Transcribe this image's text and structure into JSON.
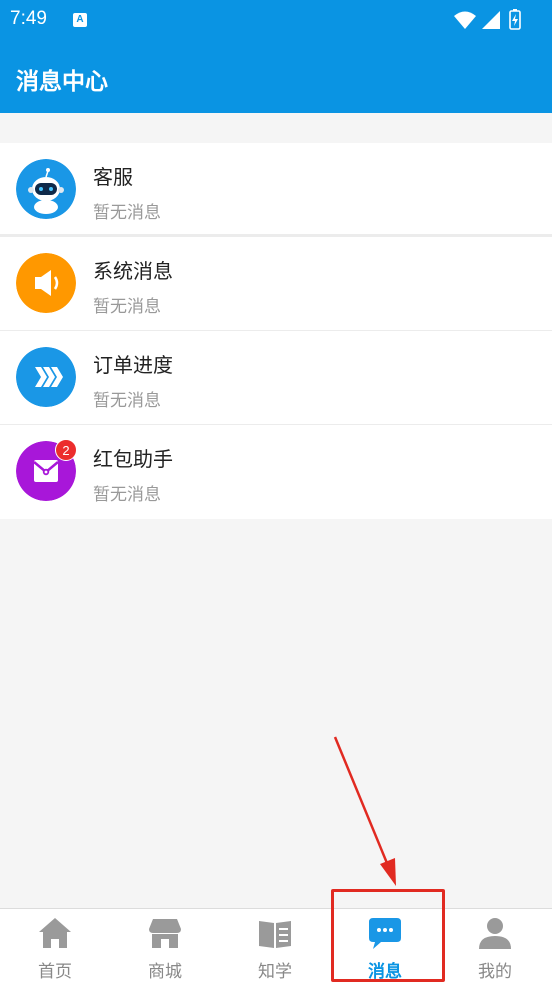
{
  "status_bar": {
    "time": "7:49",
    "a_label": "A"
  },
  "app_bar": {
    "title": "消息中心"
  },
  "messages": [
    {
      "name": "客服",
      "preview": "暂无消息",
      "icon": "robot-icon",
      "color": "#1a97e6"
    },
    {
      "name": "系统消息",
      "preview": "暂无消息",
      "icon": "speaker-icon",
      "color": "#ff9800"
    },
    {
      "name": "订单进度",
      "preview": "暂无消息",
      "icon": "progress-chevrons-icon",
      "color": "#1a97e6"
    },
    {
      "name": "红包助手",
      "preview": "暂无消息",
      "icon": "red-envelope-icon",
      "color": "#a817d9",
      "badge": "2"
    }
  ],
  "tabs": [
    {
      "label": "首页",
      "icon": "home-icon",
      "active": false
    },
    {
      "label": "商城",
      "icon": "store-icon",
      "active": false
    },
    {
      "label": "知学",
      "icon": "book-icon",
      "active": false
    },
    {
      "label": "消息",
      "icon": "chat-bubble-icon",
      "active": true
    },
    {
      "label": "我的",
      "icon": "person-icon",
      "active": false
    }
  ],
  "colors": {
    "accent": "#0a94e3",
    "annotation": "#e12a21",
    "inactive_tab": "#888888"
  }
}
